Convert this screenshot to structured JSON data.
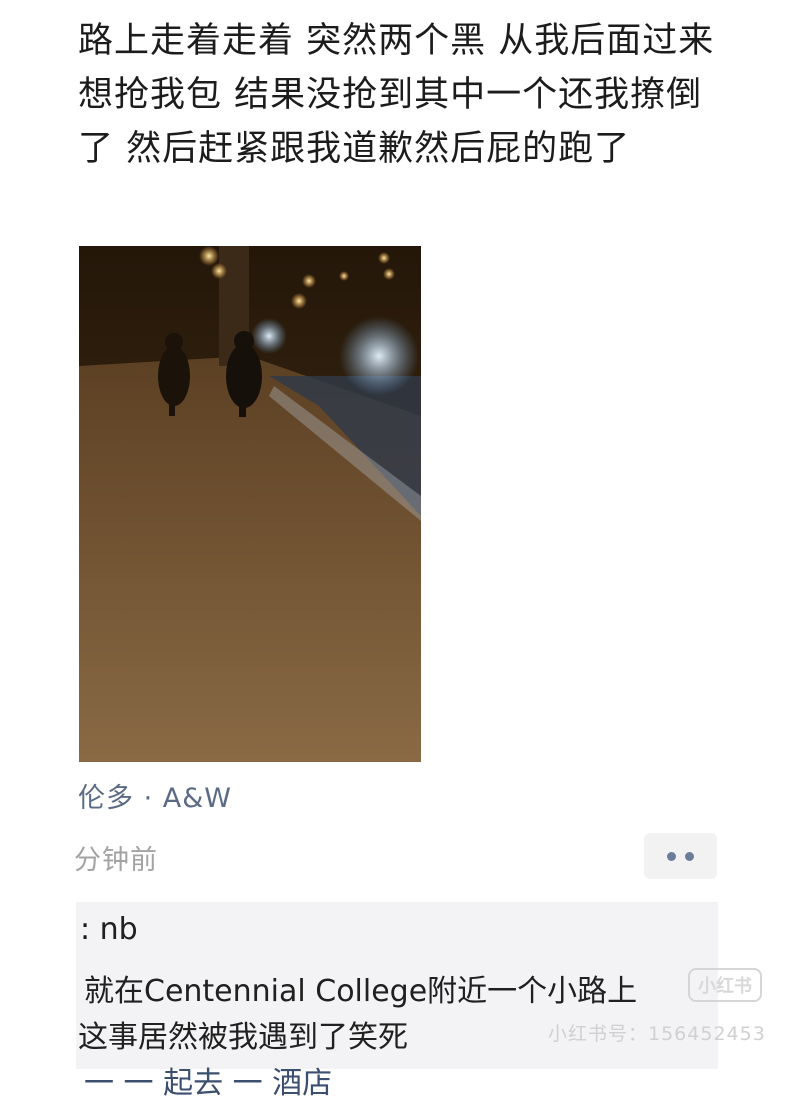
{
  "post": {
    "text": "路上走着走着 突然两个黑 从我后面过来想抢我包 结果没抢到其中一个还我撩倒了 然后赶紧跟我道歉然后屁的跑了"
  },
  "meta": {
    "location": "伦多 · A&W",
    "time": "分钟前"
  },
  "comments": [
    {
      "author": ":",
      "text": "nb"
    },
    {
      "text": "就在Centennial College附近一个小路上"
    },
    {
      "text": "这事居然被我遇到了笑死"
    },
    {
      "text": "一 一 起去 一 酒店"
    }
  ],
  "watermark": {
    "logo_text": "小红书",
    "id_text": "小红书号：156452453"
  },
  "icons": {
    "more": "more-dots-icon"
  }
}
